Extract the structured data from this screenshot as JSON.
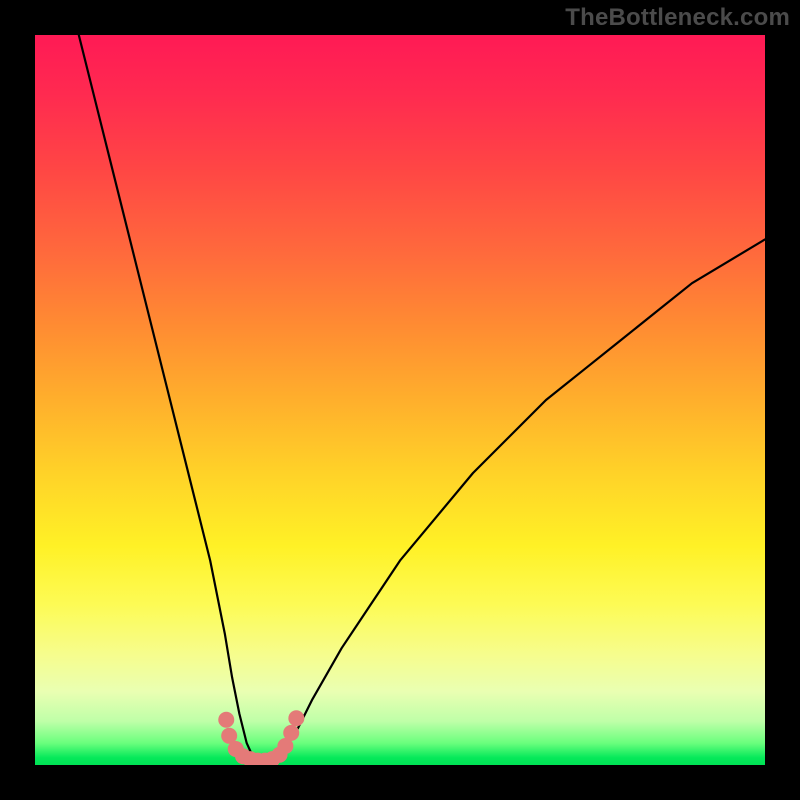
{
  "watermark": "TheBottleneck.com",
  "colors": {
    "frame": "#000000",
    "gradient_top": "#ff1a55",
    "gradient_mid": "#ffd228",
    "gradient_bottom": "#00e255",
    "curve": "#000000",
    "marker": "#e47a78"
  },
  "chart_data": {
    "type": "line",
    "title": "",
    "xlabel": "",
    "ylabel": "",
    "xlim": [
      0,
      100
    ],
    "ylim": [
      0,
      100
    ],
    "grid": false,
    "legend": false,
    "series": [
      {
        "name": "bottleneck-curve",
        "x": [
          6,
          8,
          10,
          12,
          14,
          16,
          18,
          20,
          22,
          24,
          26,
          27,
          28,
          29,
          30,
          31,
          32,
          33,
          34,
          36,
          38,
          42,
          46,
          50,
          55,
          60,
          65,
          70,
          75,
          80,
          85,
          90,
          95,
          100
        ],
        "values": [
          100,
          92,
          84,
          76,
          68,
          60,
          52,
          44,
          36,
          28,
          18,
          12,
          7,
          3,
          0.8,
          0.5,
          0.5,
          0.8,
          2,
          5,
          9,
          16,
          22,
          28,
          34,
          40,
          45,
          50,
          54,
          58,
          62,
          66,
          69,
          72
        ]
      }
    ],
    "markers": {
      "name": "salmon-dots",
      "points_x": [
        26.2,
        26.6,
        27.5,
        28.5,
        29.5,
        30.5,
        31.5,
        32.5,
        33.5,
        34.3,
        35.1,
        35.8
      ],
      "points_y": [
        6.2,
        4.0,
        2.2,
        1.2,
        0.8,
        0.6,
        0.6,
        0.8,
        1.4,
        2.6,
        4.4,
        6.4
      ]
    },
    "annotations": []
  }
}
